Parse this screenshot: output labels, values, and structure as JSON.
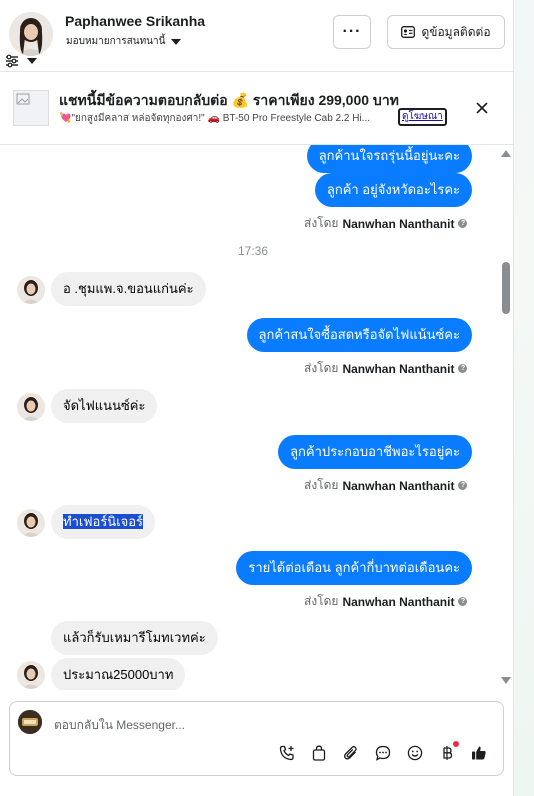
{
  "header": {
    "contact_name": "Paphanwee Srikanha",
    "assign_label": "มอบหมายการสนทนานี้",
    "more_label": "···",
    "contact_info_label": "ดูข้อมูลติดต่อ"
  },
  "ad": {
    "title": "แชทนี้มีข้อความตอบกลับต่อ 💰 ราคาเพียง 299,000 บาท",
    "subtitle": "💘\"ยกสูงมีคลาส หล่อจัดทุกองศา!\" 🚗 BT-50 Pro Freestyle Cab 2.2 Hi...",
    "link_label": "ดูโฆษณา"
  },
  "messages": {
    "out_1": "ลูกค้านใจรถรุ่นนี้อยู่นะคะ",
    "out_2": "ลูกค้า  อยู่จังหวัดอะไรคะ",
    "sent_by_label": "ส่งโดย",
    "sender": "Nanwhan Nanthanit",
    "time": "17:36",
    "in_1": "อ .ชุมแพ.จ.ขอนแก่นค่ะ",
    "out_3": "ลูกค้าสนใจซื้อสดหรือจัดไฟแน้นซ์คะ",
    "in_2": "จัดไฟแนนซ์ค่ะ",
    "out_4": "ลูกค้าประกอบอาชีพอะไรอยู่คะ",
    "in_3": "ทำเฟอร์นิเจอร์",
    "out_5": "รายได้ต่อเดือน ลูกค้ากี่บาทต่อเดือนคะ",
    "in_4": "แล้วก็รับเหมารีโมทเวทค่ะ",
    "in_5": "ประมาณ25000บาท"
  },
  "composer": {
    "placeholder": "ตอบกลับใน Messenger..."
  },
  "colors": {
    "outgoing_bubble": "#0a7cff",
    "incoming_bubble": "#f0f0f0",
    "selection_highlight": "#1a4fd1"
  }
}
